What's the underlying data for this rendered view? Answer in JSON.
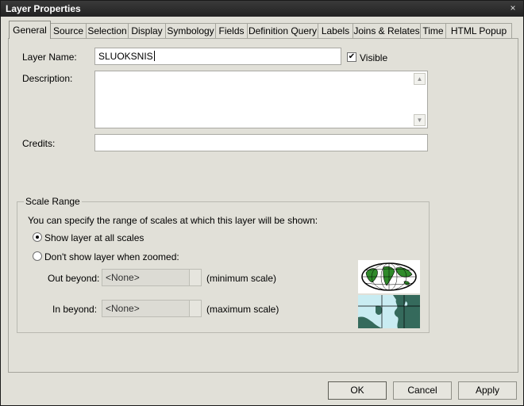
{
  "window": {
    "title": "Layer Properties",
    "close_glyph": "×"
  },
  "tabs": [
    {
      "label": "General",
      "active": true
    },
    {
      "label": "Source"
    },
    {
      "label": "Selection"
    },
    {
      "label": "Display"
    },
    {
      "label": "Symbology"
    },
    {
      "label": "Fields"
    },
    {
      "label": "Definition Query"
    },
    {
      "label": "Labels"
    },
    {
      "label": "Joins & Relates"
    },
    {
      "label": "Time"
    },
    {
      "label": "HTML Popup"
    }
  ],
  "general": {
    "layer_name_label": "Layer Name:",
    "layer_name_value": "SLUOKSNIS",
    "visible_label": "Visible",
    "visible_checked": true,
    "description_label": "Description:",
    "description_value": "",
    "credits_label": "Credits:",
    "credits_value": ""
  },
  "scale_range": {
    "title": "Scale Range",
    "intro": "You can specify the range of scales at which this layer will be shown:",
    "option_all": "Show layer at all scales",
    "option_zoomed": "Don't show layer when zoomed:",
    "selected": "all",
    "out_beyond_label": "Out beyond:",
    "out_beyond_value": "<None>",
    "out_beyond_note": "(minimum scale)",
    "in_beyond_label": "In beyond:",
    "in_beyond_value": "<None>",
    "in_beyond_note": "(maximum scale)"
  },
  "buttons": {
    "ok": "OK",
    "cancel": "Cancel",
    "apply": "Apply"
  },
  "colors": {
    "globe_land": "#2f8a2a",
    "coast_water": "#c9ecf2",
    "coast_land": "#356a5c"
  }
}
